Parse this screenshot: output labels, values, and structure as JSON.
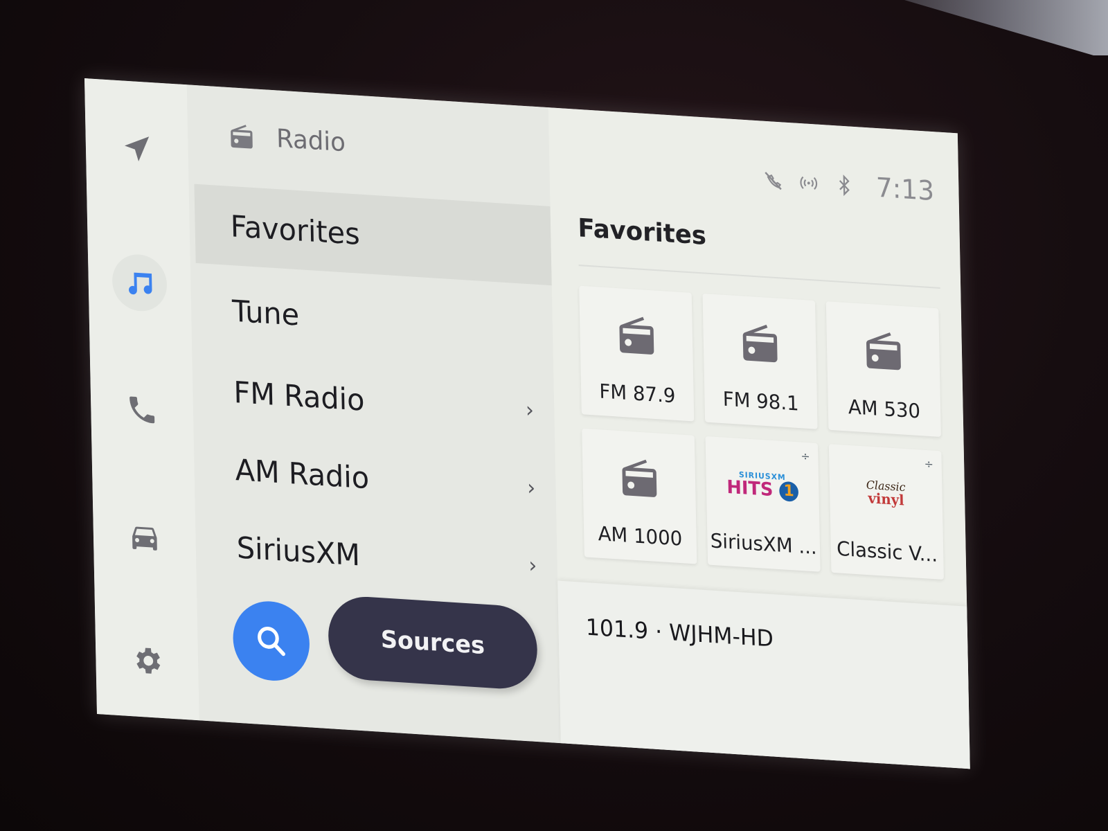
{
  "rail": {
    "items": [
      {
        "icon": "navigation-arrow-icon",
        "label": "Navigation",
        "active": false
      },
      {
        "icon": "music-note-icon",
        "label": "Media",
        "active": true
      },
      {
        "icon": "phone-icon",
        "label": "Phone",
        "active": false
      },
      {
        "icon": "car-icon",
        "label": "Vehicle",
        "active": false
      },
      {
        "icon": "gear-icon",
        "label": "Settings",
        "active": false
      }
    ],
    "active_color": "#3b82f0"
  },
  "nav_panel": {
    "header": {
      "icon": "radio-icon",
      "title": "Radio"
    },
    "items": [
      {
        "label": "Favorites",
        "selected": true,
        "chevron": ""
      },
      {
        "label": "Tune",
        "selected": false,
        "chevron": ""
      },
      {
        "label": "FM Radio",
        "selected": false,
        "chevron": "›"
      },
      {
        "label": "AM Radio",
        "selected": false,
        "chevron": "›"
      },
      {
        "label": "SiriusXM",
        "selected": false,
        "chevron": "›"
      }
    ],
    "search_button": {
      "icon": "search-icon",
      "color": "#3b82f0"
    },
    "sources_button": {
      "label": "Sources",
      "color": "#35344a"
    }
  },
  "status_bar": {
    "icons": [
      "phone-muted-icon",
      "cellular-signal-icon",
      "bluetooth-icon"
    ],
    "time": "7:13"
  },
  "content": {
    "title": "Favorites",
    "tiles": [
      {
        "label": "FM 87.9",
        "art": "radio-icon",
        "badge": ""
      },
      {
        "label": "FM 98.1",
        "art": "radio-icon",
        "badge": ""
      },
      {
        "label": "AM 530",
        "art": "radio-icon",
        "badge": ""
      },
      {
        "label": "AM 1000",
        "art": "radio-icon",
        "badge": ""
      },
      {
        "label": "SiriusXM ...",
        "art": "siriusxm-hits1-logo",
        "badge": "÷",
        "logo_small": "SIRIUSXM",
        "logo_main": "HITS",
        "logo_number": "1"
      },
      {
        "label": "Classic V...",
        "art": "classic-vinyl-logo",
        "badge": "÷",
        "logo_line1": "Classic",
        "logo_line2": "vinyl"
      }
    ]
  },
  "now_playing": {
    "text": "101.9 · WJHM-HD"
  }
}
